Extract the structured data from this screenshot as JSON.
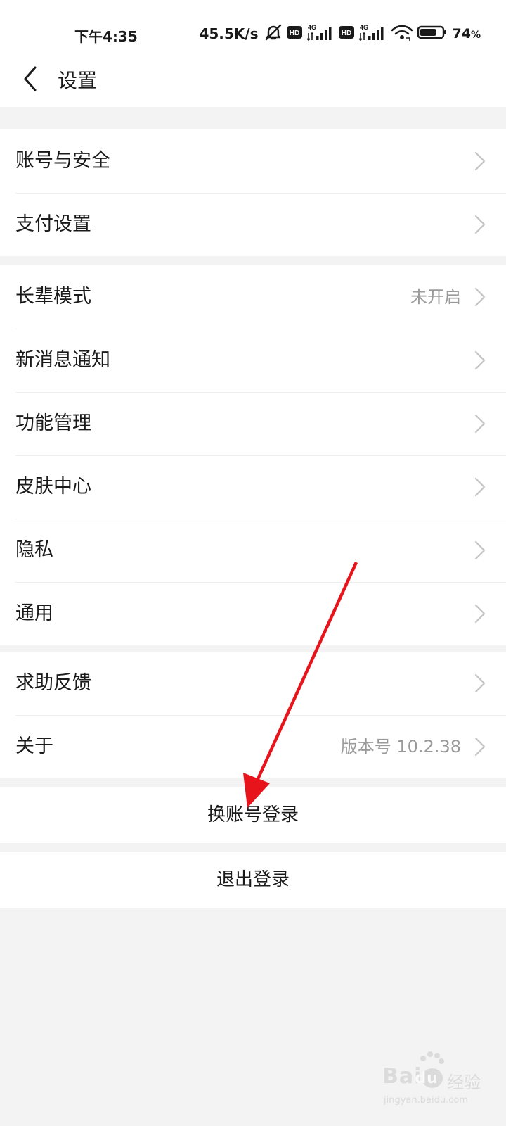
{
  "status_bar": {
    "time": "下午4:35",
    "network_speed": "45.5K/s",
    "battery_percent": "74",
    "battery_unit": "%",
    "battery_level": 0.74,
    "signal_label_1": "4G",
    "signal_label_2": "4G",
    "hd_label": "HD",
    "icons": [
      "mute-bell-icon",
      "hd-icon",
      "signal-4g-icon",
      "hd-icon",
      "signal-4g-icon",
      "wifi-icon",
      "battery-icon"
    ]
  },
  "header": {
    "back_icon": "chevron-left-icon",
    "title": "设置"
  },
  "groups": {
    "account": [
      {
        "label": "账号与安全",
        "value": ""
      },
      {
        "label": "支付设置",
        "value": ""
      }
    ],
    "preferences": [
      {
        "label": "长辈模式",
        "value": "未开启"
      },
      {
        "label": "新消息通知",
        "value": ""
      },
      {
        "label": "功能管理",
        "value": ""
      },
      {
        "label": "皮肤中心",
        "value": ""
      },
      {
        "label": "隐私",
        "value": ""
      },
      {
        "label": "通用",
        "value": ""
      }
    ],
    "support": [
      {
        "label": "求助反馈",
        "value": ""
      },
      {
        "label": "关于",
        "value": "版本号 10.2.38"
      }
    ]
  },
  "actions": {
    "switch_account": "换账号登录",
    "logout": "退出登录"
  },
  "annotation": {
    "arrow_color": "#e8141c"
  },
  "watermark": {
    "brand": "Bai",
    "brand_accent": "du",
    "sub": "经验",
    "url": "jingyan.baidu.com"
  },
  "colors": {
    "background": "#f3f3f3",
    "surface": "#ffffff",
    "text": "#1a1a1a",
    "secondary_text": "#9a9a9a",
    "chevron": "#c4c4c4"
  }
}
